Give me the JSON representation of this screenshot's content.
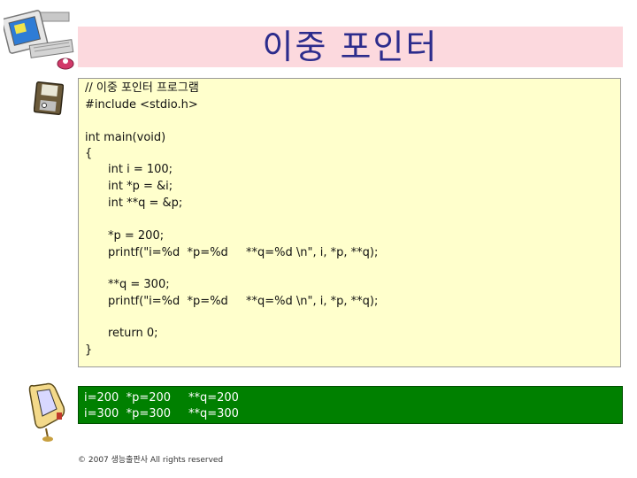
{
  "slide": {
    "title": "이중 포인터",
    "code": {
      "comment": "// 이중 포인터 프로그램",
      "include": "#include <stdio.h>",
      "main_sig": "int main(void)",
      "open_brace": "{",
      "decl1": "int i = 100;",
      "decl2": "int *p = &i;",
      "decl3": "int **q = &p;",
      "assign1": "*p = 200;",
      "printf1_a": "printf(\"i=%d  *p=%d",
      "printf1_b": "**q=%d \\n\", i, *p, **q);",
      "assign2": "**q = 300;",
      "printf2_a": "printf(\"i=%d  *p=%d",
      "printf2_b": "**q=%d \\n\", i, *p, **q);",
      "ret": "return 0;",
      "close_brace": "}"
    },
    "output": {
      "line1_a": "i=200  *p=200",
      "line1_b": "**q=200",
      "line2_a": "i=300  *p=300",
      "line2_b": "**q=300"
    },
    "footer": "© 2007 생능출판사 All rights reserved",
    "colors": {
      "title_bg": "#fcd9de",
      "title_text": "#2c2c8c",
      "code_bg": "#ffffcc",
      "output_bg": "#008000"
    },
    "icons": [
      "computer-icon",
      "floppy-disk-icon",
      "pda-icon"
    ]
  }
}
